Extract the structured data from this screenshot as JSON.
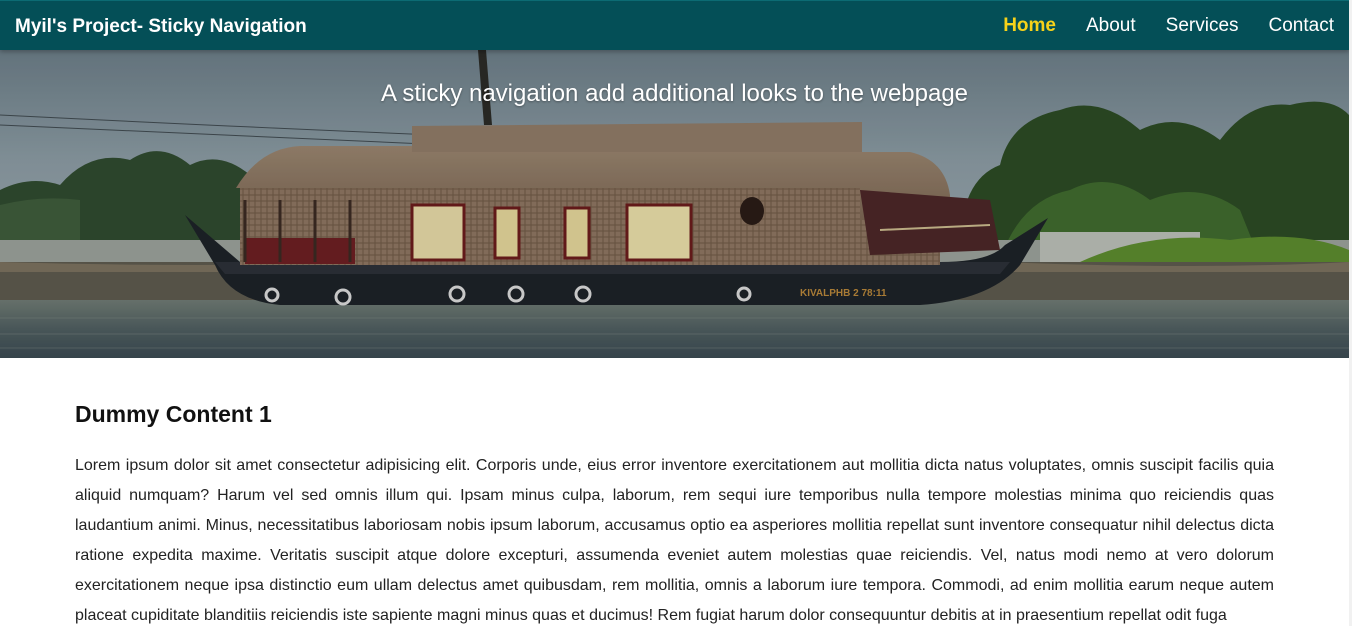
{
  "navbar": {
    "brand": "Myil's Project- Sticky Navigation",
    "links": [
      {
        "label": "Home",
        "active": true
      },
      {
        "label": "About",
        "active": false
      },
      {
        "label": "Services",
        "active": false
      },
      {
        "label": "Contact",
        "active": false
      }
    ],
    "background_color": "#044f57",
    "active_color": "#f7d21a"
  },
  "hero": {
    "subtitle": "A sticky navigation add additional looks to the webpage",
    "image": "houseboat-on-backwater-photo"
  },
  "content": {
    "heading": "Dummy Content 1",
    "paragraph": "Lorem ipsum dolor sit amet consectetur adipisicing elit. Corporis unde, eius error inventore exercitationem aut mollitia dicta natus voluptates, omnis suscipit facilis quia aliquid numquam? Harum vel sed omnis illum qui. Ipsam minus culpa, laborum, rem sequi iure temporibus nulla tempore molestias minima quo reiciendis quas laudantium animi. Minus, necessitatibus laboriosam nobis ipsum laborum, accusamus optio ea asperiores mollitia repellat sunt inventore consequatur nihil delectus dicta ratione expedita maxime. Veritatis suscipit atque dolore excepturi, assumenda eveniet autem molestias quae reiciendis. Vel, natus modi nemo at vero dolorum exercitationem neque ipsa distinctio eum ullam delectus amet quibusdam, rem mollitia, omnis a laborum iure tempora. Commodi, ad enim mollitia earum neque autem placeat cupiditate blanditiis reiciendis iste sapiente magni minus quas et ducimus! Rem fugiat harum dolor consequuntur debitis at in praesentium repellat odit fuga"
  }
}
